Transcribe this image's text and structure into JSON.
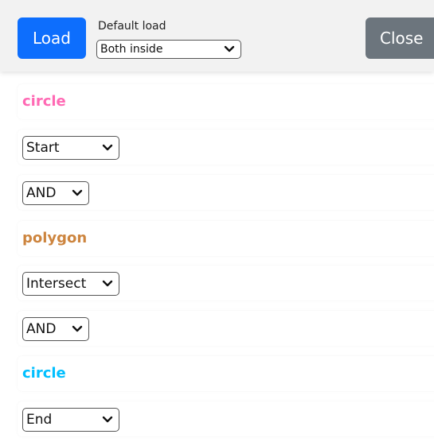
{
  "toolbar": {
    "load_label": "Load",
    "default_load_label": "Default load",
    "default_load_value": "Both inside",
    "close_label": "Close"
  },
  "items": [
    {
      "kind": "shape",
      "label": "circle",
      "color": "#ff69b4"
    },
    {
      "kind": "select",
      "value": "Start"
    },
    {
      "kind": "select",
      "value": "AND"
    },
    {
      "kind": "shape",
      "label": "polygon",
      "color": "#cd853f"
    },
    {
      "kind": "select",
      "value": "Intersect"
    },
    {
      "kind": "select",
      "value": "AND"
    },
    {
      "kind": "shape",
      "label": "circle",
      "color": "#00bfff"
    },
    {
      "kind": "select",
      "value": "End"
    }
  ],
  "colors": {
    "primary": "#0d6efd",
    "secondary": "#6c757d",
    "toolbar_bg": "#f2f2f2"
  }
}
